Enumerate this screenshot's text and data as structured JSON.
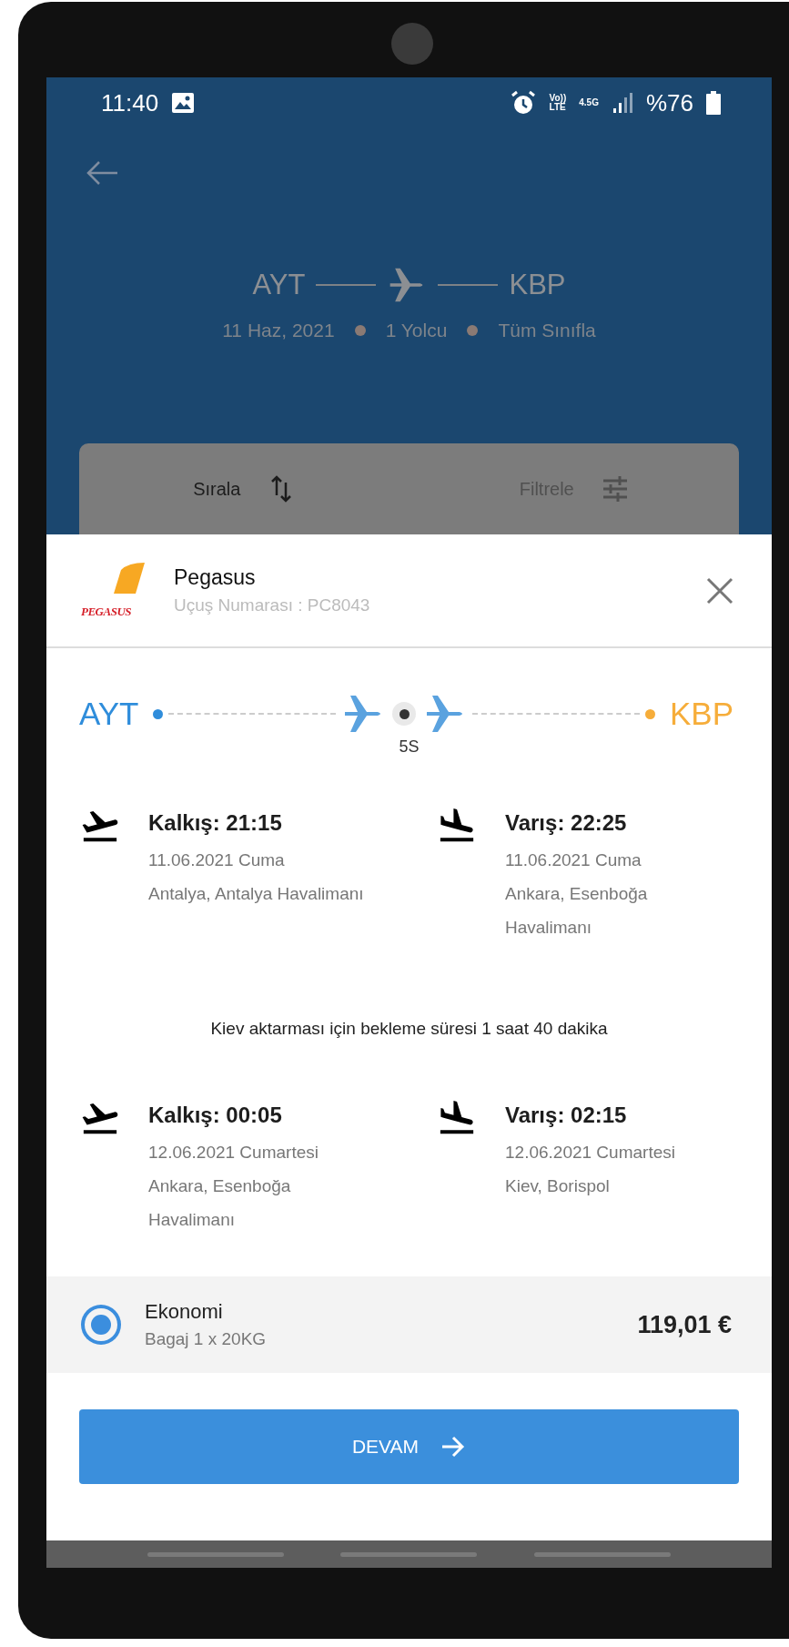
{
  "status_bar": {
    "time": "11:40",
    "volte": [
      "Vo))",
      "LTE"
    ],
    "network": "4.5G",
    "battery": "%76"
  },
  "header": {
    "origin": "AYT",
    "destination": "KBP",
    "details": [
      "11 Haz, 2021",
      "1 Yolcu",
      "Tüm Sınıfla"
    ]
  },
  "toolbar": {
    "sort": "Sırala",
    "filter": "Filtrele"
  },
  "sheet": {
    "logo_text": "PEGASUS",
    "airline": "Pegasus",
    "flight_number": "Uçuş Numarası : PC8043",
    "route": {
      "origin": "AYT",
      "stop": "5S",
      "destination": "KBP"
    },
    "segments": [
      {
        "departure": {
          "time": "Kalkış: 21:15",
          "date": "11.06.2021 Cuma",
          "place": "Antalya, Antalya Havalimanı"
        },
        "arrival": {
          "time": "Varış: 22:25",
          "date": "11.06.2021 Cuma",
          "place": "Ankara, Esenboğa Havalimanı"
        }
      },
      {
        "departure": {
          "time": "Kalkış: 00:05",
          "date": "12.06.2021 Cumartesi",
          "place": "Ankara, Esenboğa Havalimanı"
        },
        "arrival": {
          "time": "Varış: 02:15",
          "date": "12.06.2021 Cumartesi",
          "place": "Kiev, Borispol"
        }
      }
    ],
    "transfer_note": "Kiev aktarması için bekleme süresi 1 saat 40 dakika",
    "fare": {
      "name": "Ekonomi",
      "baggage": "Bagaj 1 x 20KG",
      "price": "119,01 €",
      "selected": true
    },
    "button": "DEVAM"
  }
}
